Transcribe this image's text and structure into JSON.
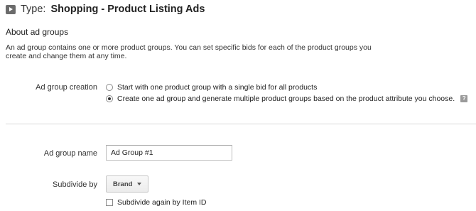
{
  "header": {
    "type_label": "Type:",
    "type_value": "Shopping - Product Listing Ads",
    "icon": "play-square-icon"
  },
  "about": {
    "title": "About ad groups",
    "description": "An ad group contains one or more product groups. You can set specific bids for each of the product groups you create and change them at any time."
  },
  "ad_group_creation": {
    "label": "Ad group creation",
    "options": [
      {
        "label": "Start with one product group with a single bid for all products",
        "selected": false
      },
      {
        "label": "Create one ad group and generate multiple product groups based on the product attribute you choose.",
        "selected": true
      }
    ],
    "help_icon": "?"
  },
  "ad_group_name": {
    "label": "Ad group name",
    "value": "Ad Group #1"
  },
  "subdivide": {
    "label": "Subdivide by",
    "selected": "Brand",
    "again_label": "Subdivide again by Item ID",
    "again_checked": false
  },
  "colors": {
    "divider": "#d9d9d9",
    "text": "#222222"
  }
}
